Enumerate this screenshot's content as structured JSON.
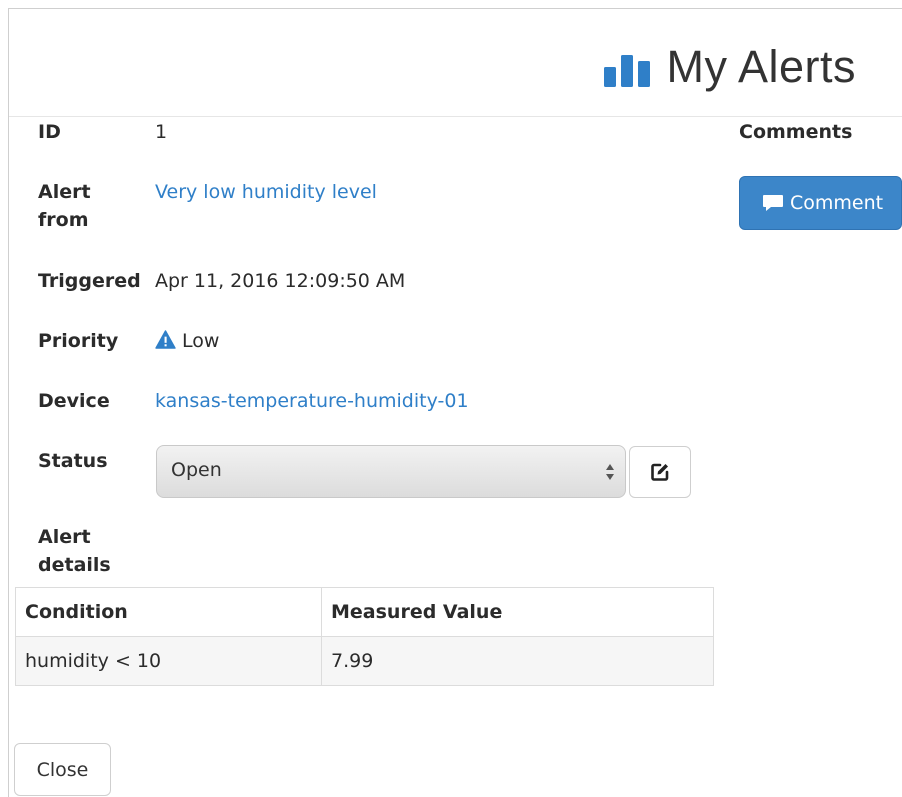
{
  "header": {
    "title": "My Alerts",
    "icon": "bar-chart-icon",
    "accent": "#2f7fc8"
  },
  "fields": {
    "id": {
      "label": "ID",
      "value": "1"
    },
    "alert_from": {
      "label_line1": "Alert",
      "label_line2": "from",
      "value": "Very low humidity level"
    },
    "triggered": {
      "label": "Triggered",
      "value": "Apr 11, 2016 12:09:50 AM"
    },
    "priority": {
      "label": "Priority",
      "value": "Low",
      "icon": "warning-icon"
    },
    "device": {
      "label": "Device",
      "value": "kansas-temperature-humidity-01"
    },
    "status": {
      "label": "Status",
      "selected": "Open",
      "edit_icon": "edit-icon"
    },
    "alert_details": {
      "label_line1": "Alert",
      "label_line2": "details"
    }
  },
  "comments": {
    "title": "Comments",
    "button_label": "Comment",
    "button_icon": "comment-icon",
    "button_color": "#3c86c9"
  },
  "details_table": {
    "headers": [
      "Condition",
      "Measured Value"
    ],
    "rows": [
      [
        "humidity < 10",
        "7.99"
      ]
    ]
  },
  "footer": {
    "close_label": "Close"
  }
}
